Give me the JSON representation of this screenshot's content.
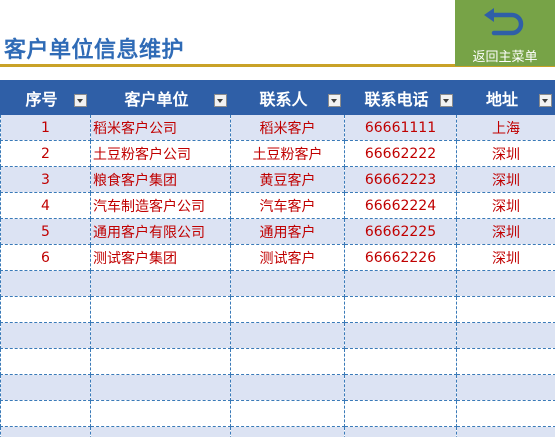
{
  "header": {
    "title": "客户单位信息维护",
    "back_button_label": "返回主菜单"
  },
  "colors": {
    "title": "#2f6bb6",
    "header_rule": "#c9a227",
    "back_button_bg": "#77a347",
    "back_icon": "#2f5fa7",
    "table_header_bg": "#2f5fa7",
    "row_band": "#dce3f3",
    "cell_text": "#c00000",
    "grid_line": "#3a7ab8"
  },
  "icons": {
    "back": "return-arrow-icon",
    "filter": "filter-dropdown-icon"
  },
  "table": {
    "columns": [
      "序号",
      "客户单位",
      "联系人",
      "联系电话",
      "地址"
    ],
    "rows": [
      [
        "1",
        "稻米客户公司",
        "稻米客户",
        "66661111",
        "上海"
      ],
      [
        "2",
        "土豆粉客户公司",
        "土豆粉客户",
        "66662222",
        "深圳"
      ],
      [
        "3",
        "粮食客户集团",
        "黄豆客户",
        "66662223",
        "深圳"
      ],
      [
        "4",
        "汽车制造客户公司",
        "汽车客户",
        "66662224",
        "深圳"
      ],
      [
        "5",
        "通用客户有限公司",
        "通用客户",
        "66662225",
        "深圳"
      ],
      [
        "6",
        "测试客户集团",
        "测试客户",
        "66662226",
        "深圳"
      ],
      [
        "",
        "",
        "",
        "",
        ""
      ],
      [
        "",
        "",
        "",
        "",
        ""
      ],
      [
        "",
        "",
        "",
        "",
        ""
      ],
      [
        "",
        "",
        "",
        "",
        ""
      ],
      [
        "",
        "",
        "",
        "",
        ""
      ],
      [
        "",
        "",
        "",
        "",
        ""
      ],
      [
        "",
        "",
        "",
        "",
        ""
      ]
    ]
  }
}
